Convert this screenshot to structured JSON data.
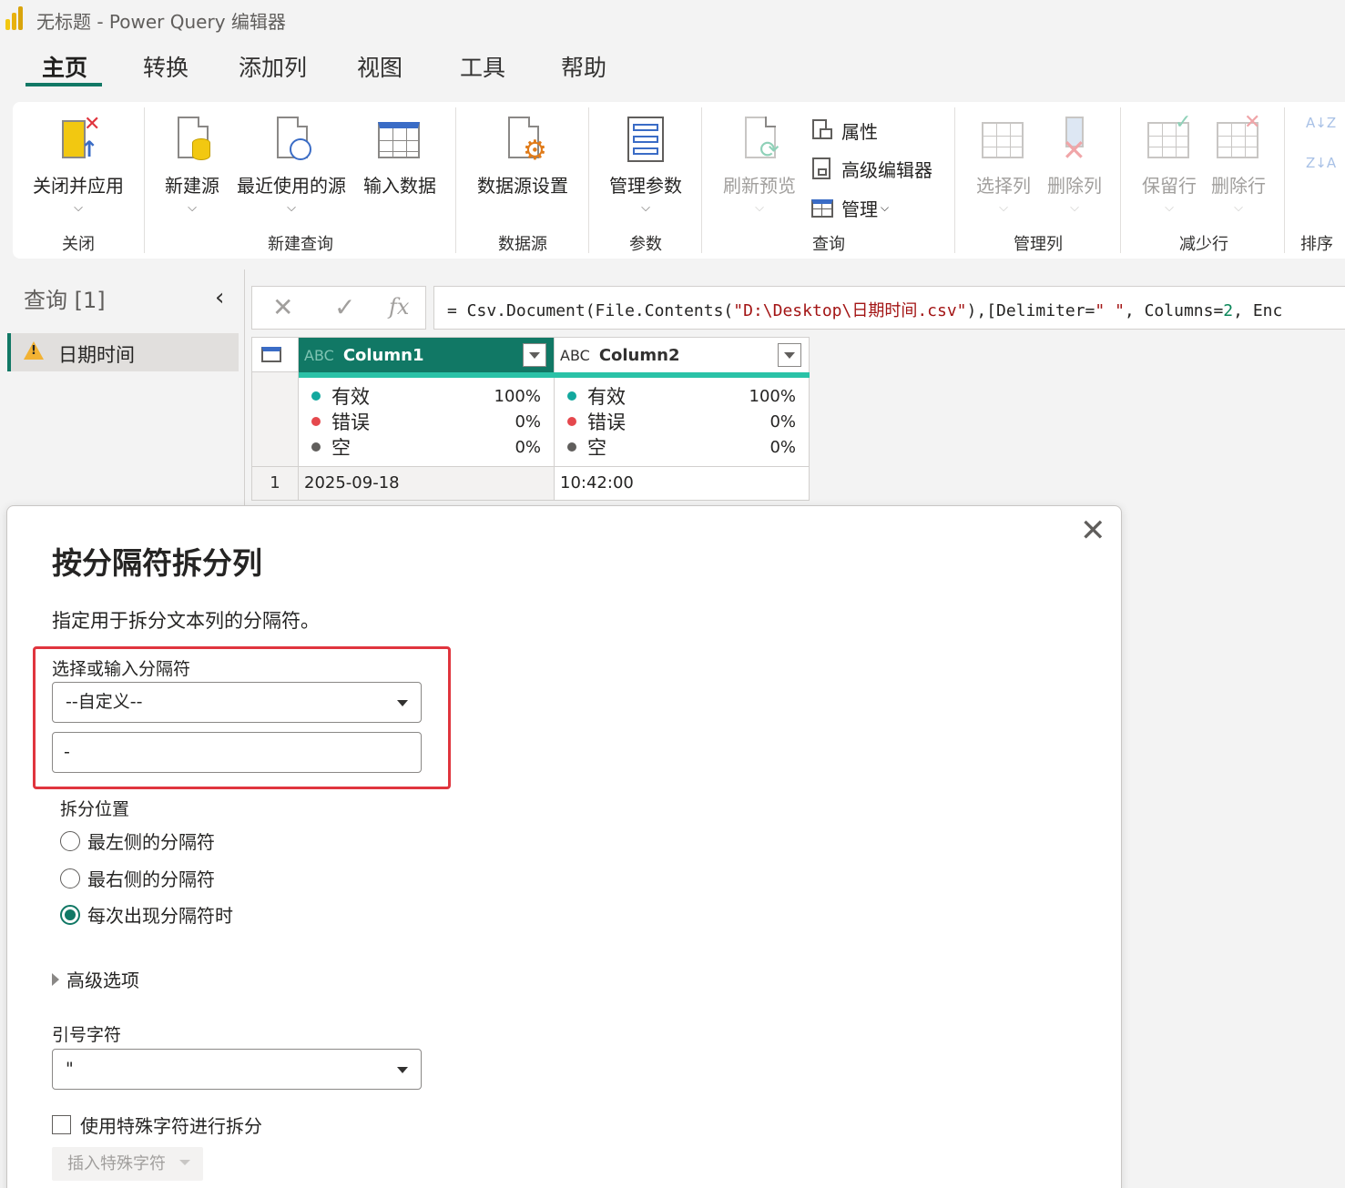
{
  "window": {
    "title": "无标题 - Power Query 编辑器"
  },
  "tabs": [
    "主页",
    "转换",
    "添加列",
    "视图",
    "工具",
    "帮助"
  ],
  "ribbon": {
    "close_apply": "关闭并应用",
    "new_source": "新建源",
    "recent_sources": "最近使用的源",
    "enter_data": "输入数据",
    "datasource_settings": "数据源设置",
    "manage_params": "管理参数",
    "refresh_preview": "刷新预览",
    "properties": "属性",
    "advanced_editor": "高级编辑器",
    "manage": "管理",
    "choose_columns": "选择列",
    "remove_columns": "删除列",
    "keep_rows": "保留行",
    "remove_rows": "删除行",
    "groups": {
      "close": "关闭",
      "new_query": "新建查询",
      "data_sources": "数据源",
      "parameters": "参数",
      "query": "查询",
      "manage_columns": "管理列",
      "reduce_rows": "减少行",
      "sort": "排序"
    },
    "sort_az": "A↓Z",
    "sort_za": "Z↓A"
  },
  "query_pane": {
    "header": "查询 [1]",
    "items": [
      {
        "label": "日期时间"
      }
    ]
  },
  "formula_bar": {
    "cancel": "✕",
    "confirm": "✓",
    "fx": "fx",
    "prefix": "= Csv.Document(File.Contents(",
    "path": "\"D:\\Desktop\\日期时间.csv\"",
    "mid": "),[Delimiter=",
    "delim": "\" \"",
    "mid2": ", Columns=",
    "cols": "2",
    "suffix": ", Enc"
  },
  "grid": {
    "type_icon": "ABC",
    "columns": [
      {
        "name": "Column1",
        "valid_label": "有效",
        "valid": "100%",
        "error_label": "错误",
        "error": "0%",
        "empty_label": "空",
        "empty": "0%"
      },
      {
        "name": "Column2",
        "valid_label": "有效",
        "valid": "100%",
        "error_label": "错误",
        "error": "0%",
        "empty_label": "空",
        "empty": "0%"
      }
    ],
    "rows": [
      {
        "num": "1",
        "c1": "2025-09-18",
        "c2": "10:42:00"
      }
    ]
  },
  "dialog": {
    "close": "✕",
    "title": "按分隔符拆分列",
    "description": "指定用于拆分文本列的分隔符。",
    "delimiter_label": "选择或输入分隔符",
    "delimiter_select": "--自定义--",
    "delimiter_value": "-",
    "split_at_label": "拆分位置",
    "options": [
      "最左侧的分隔符",
      "最右侧的分隔符",
      "每次出现分隔符时"
    ],
    "selected_option": "每次出现分隔符时",
    "advanced": "高级选项",
    "quote_label": "引号字符",
    "quote_value": "\"",
    "special_chars": "使用特殊字符进行拆分",
    "insert_special": "插入特殊字符"
  },
  "colors": {
    "accent": "#117865",
    "quality_bar": "#2ac2a7",
    "valid_dot": "#13a89e",
    "error_dot": "#e5484d",
    "empty_dot": "#605e5c",
    "highlight_box": "#e0353e"
  }
}
